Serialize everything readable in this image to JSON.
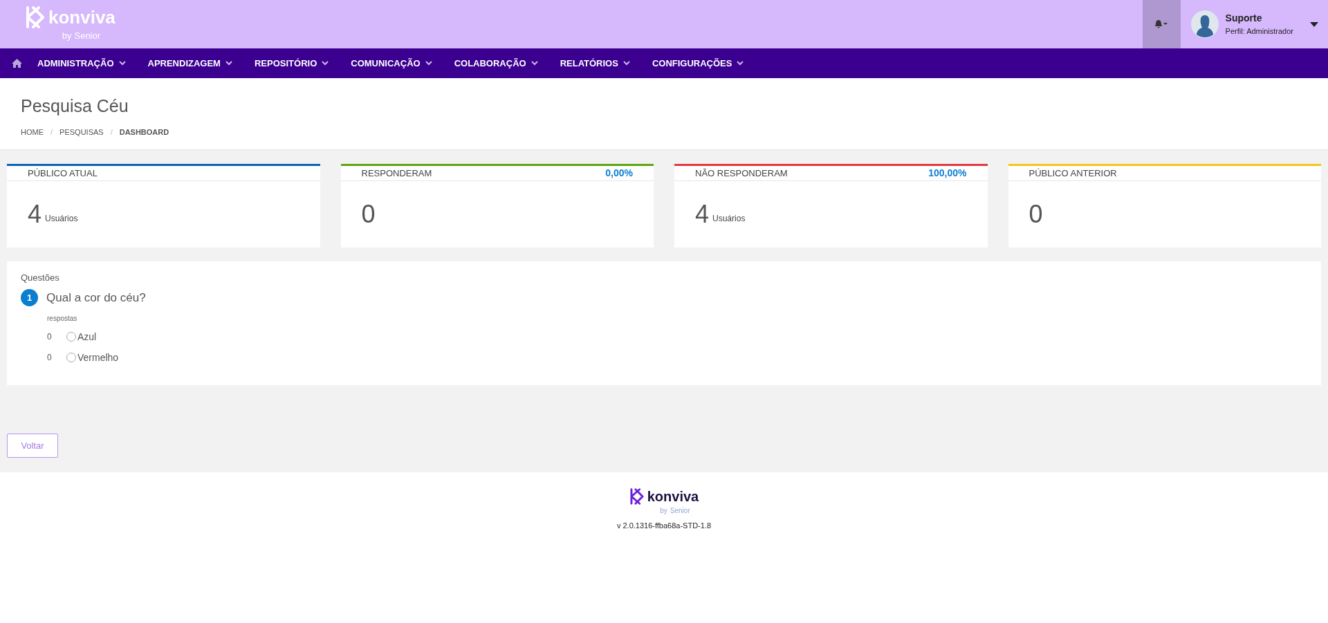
{
  "header": {
    "logo": {
      "name": "konviva",
      "byline": "by",
      "brand": "Senior"
    },
    "notifications": {
      "active": true
    },
    "user": {
      "name": "Suporte",
      "profile": "Perfil: Administrador"
    }
  },
  "nav": {
    "items": [
      {
        "label": "ADMINISTRAÇÃO"
      },
      {
        "label": "APRENDIZAGEM"
      },
      {
        "label": "REPOSITÓRIO"
      },
      {
        "label": "COMUNICAÇÃO"
      },
      {
        "label": "COLABORAÇÃO"
      },
      {
        "label": "RELATÓRIOS"
      },
      {
        "label": "CONFIGURAÇÕES"
      }
    ]
  },
  "page": {
    "title": "Pesquisa Céu",
    "breadcrumb_separators": [
      "/",
      "/"
    ],
    "breadcrumb": [
      {
        "label": "HOME",
        "current": false
      },
      {
        "label": "PESQUISAS",
        "current": false
      },
      {
        "label": "DASHBOARD",
        "current": true
      }
    ]
  },
  "cards": [
    {
      "title": "PÚBLICO ATUAL",
      "color": "#0a63b0",
      "value": "4",
      "unit": "Usuários"
    },
    {
      "title": "RESPONDERAM",
      "color": "#5fa40f",
      "percent": "0,00%",
      "value": "0"
    },
    {
      "title": "NÃO RESPONDERAM",
      "color": "#e0383e",
      "percent": "100,00%",
      "value": "4",
      "unit": "Usuários"
    },
    {
      "title": "PÚBLICO ANTERIOR",
      "color": "#f5c518",
      "value": "0"
    }
  ],
  "questions": {
    "heading": "Questões",
    "items": [
      {
        "number": "1",
        "text": "Qual a cor do céu?",
        "answers_label": "respostas",
        "options": [
          {
            "count": "0",
            "label": "Azul",
            "selected": false
          },
          {
            "count": "0",
            "label": "Vermelho",
            "selected": false
          }
        ]
      }
    ]
  },
  "back_button": "Voltar",
  "footer": {
    "logo": {
      "name": "konviva",
      "byline": "by",
      "brand": "Senior"
    },
    "version": "v 2.0.1316-ffba68a-STD-1.8"
  }
}
